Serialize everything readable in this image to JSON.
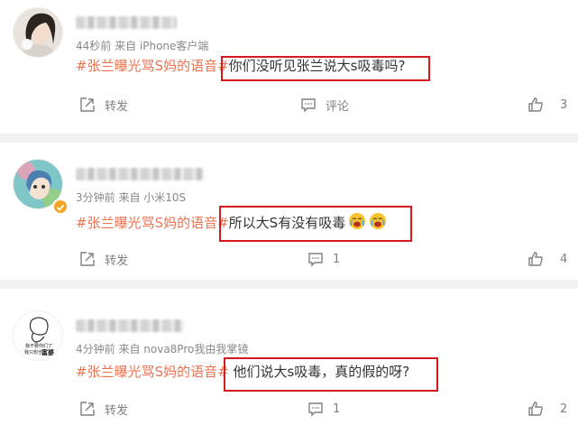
{
  "topic": "#张兰曝光骂S妈的语音#",
  "comments": [
    {
      "meta": "44秒前  来自 iPhone客户端",
      "text": "你们没听见张兰说大s吸毒吗?",
      "repost_label": "转发",
      "comment_label": "评论",
      "like_count": "3"
    },
    {
      "meta": "3分钟前  来自 小米10S",
      "text": "所以大S有没有吸毒",
      "emojis": [
        "crying-face",
        "crying-face"
      ],
      "repost_label": "转发",
      "comment_count": "1",
      "like_count": "4"
    },
    {
      "meta": "4分钟前  来自 nova8Pro我由我掌镜",
      "text": " 他们说大s吸毒，真的假的呀?",
      "repost_label": "转发",
      "comment_count": "1",
      "like_count": "2"
    }
  ],
  "avatar3_text": [
    "我不要你们了",
    "我只想当",
    "富婆"
  ],
  "colors": {
    "topic": "#eb7350",
    "highlight": "#d6191f",
    "separator": "#f2f2f2"
  },
  "icons": [
    "repost-icon",
    "comment-icon",
    "like-icon",
    "verified-badge-icon"
  ]
}
